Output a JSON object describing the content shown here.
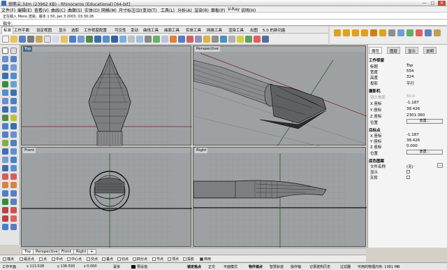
{
  "window": {
    "title": "钢笔尖.3dm (23962 KB) - Rhinoceros (Educational) [64-bit]",
    "controls": [
      "—",
      "□",
      "✕"
    ]
  },
  "menu": [
    "文件(F)",
    "编辑(E)",
    "查看(V)",
    "曲线(C)",
    "曲面(S)",
    "实体(O)",
    "网格(M)",
    "尺寸标注(D)",
    "变动(T)",
    "工具(L)",
    "分析(A)",
    "渲染(R)",
    "面板(P)",
    "V-Ray",
    "说明(H)"
  ],
  "command": {
    "history": "正在载入 Mono 渲染，版本 1.50, Jan 3 2003, 03:30:28",
    "prompt": "指令:"
  },
  "toolbar_tabs": [
    "标准",
    "工作平面",
    "设定视图",
    "显示",
    "选取",
    "工作视窗配置",
    "可见性",
    "变动",
    "曲线工具",
    "曲面工具",
    "实体工具",
    "网格工具",
    "渲染工具",
    "出图",
    "5.0 的新功能"
  ],
  "viewports": {
    "top": "Top",
    "perspective": "Perspective",
    "front": "Front",
    "right": "Right"
  },
  "viewport_tabs": [
    "Top",
    "Perspective",
    "Front",
    "Right",
    "+"
  ],
  "snaps": [
    "端点",
    "最近点",
    "点",
    "中点",
    "中心点",
    "交点",
    "垂点",
    "切点",
    "四分点",
    "节点",
    "顶点",
    "投影",
    "停用"
  ],
  "snap_states": [
    false,
    false,
    false,
    false,
    false,
    false,
    false,
    false,
    false,
    false,
    false,
    false,
    true
  ],
  "status": {
    "cplane": "工作平面",
    "x": "x 113.528",
    "y": "y 136.593",
    "z": "z 0.000",
    "unit": "毫米",
    "layer": "预设值",
    "grid_snap": "锁定格点",
    "ortho": "正交",
    "planar": "平面模式",
    "osnap": "物件锁点",
    "smarttrack": "智慧轨迹",
    "gumball": "操作轴",
    "history": "记录建构历史",
    "filter": "过滤器",
    "memory": "可用的物理内存: 1381 MB"
  },
  "panel": {
    "tabs": [
      "属性",
      "图层",
      "显示",
      "说明"
    ],
    "viewport_section": "工作视窗",
    "fields": [
      {
        "label": "标题",
        "value": "Top"
      },
      {
        "label": "宽度",
        "value": "554"
      },
      {
        "label": "高度",
        "value": "324"
      },
      {
        "label": "投影",
        "value": "平行"
      }
    ],
    "camera_section": "摄影机",
    "camera_fields": [
      {
        "label": "镜头焦距",
        "value": "50.0"
      },
      {
        "label": "X 座标",
        "value": "-1.187"
      },
      {
        "label": "Y 座标",
        "value": "38.426"
      },
      {
        "label": "Z 座标",
        "value": "2301.360"
      },
      {
        "label": "位置",
        "value": "放置..."
      }
    ],
    "target_section": "目标点",
    "target_fields": [
      {
        "label": "X 座标",
        "value": "-1.187"
      },
      {
        "label": "Y 座标",
        "value": "38.426"
      },
      {
        "label": "Z 座标",
        "value": "0.000"
      },
      {
        "label": "位置",
        "value": "放置..."
      }
    ],
    "wallpaper_section": "底色图案",
    "wallpaper_fields": [
      {
        "label": "文件名称",
        "value": "(无)"
      },
      {
        "label": "显示",
        "value": ""
      },
      {
        "label": "灰阶",
        "value": ""
      }
    ]
  }
}
